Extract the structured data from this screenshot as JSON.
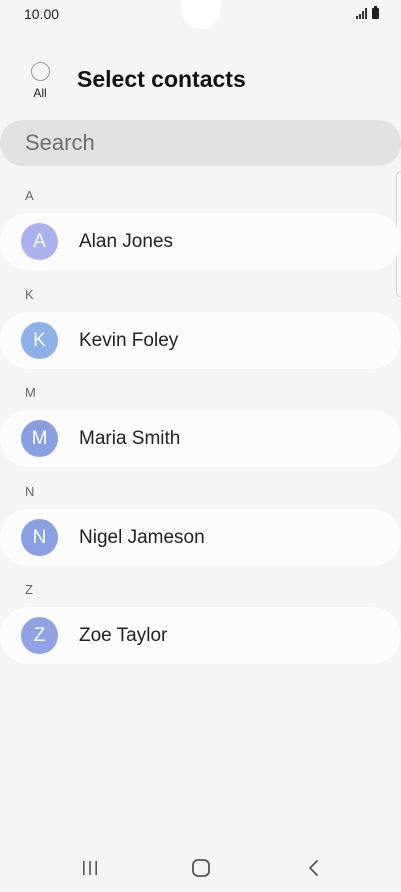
{
  "status_bar": {
    "time": "10.00",
    "icons": [
      "signal-icon",
      "battery-icon"
    ]
  },
  "header": {
    "all_label": "All",
    "title": "Select contacts"
  },
  "search": {
    "placeholder": "Search"
  },
  "sections": [
    {
      "letter": "A",
      "contact": {
        "initial": "A",
        "name": "Alan Jones",
        "avatar_color": "#a9b2ee"
      }
    },
    {
      "letter": "K",
      "contact": {
        "initial": "K",
        "name": "Kevin Foley",
        "avatar_color": "#8eb0e8"
      }
    },
    {
      "letter": "M",
      "contact": {
        "initial": "M",
        "name": "Maria Smith",
        "avatar_color": "#8a9ee2"
      }
    },
    {
      "letter": "N",
      "contact": {
        "initial": "N",
        "name": "Nigel Jameson",
        "avatar_color": "#8aa0e2"
      }
    },
    {
      "letter": "Z",
      "contact": {
        "initial": "Z",
        "name": "Zoe Taylor",
        "avatar_color": "#8fa2e4"
      }
    }
  ],
  "nav_bar": {
    "icons": [
      "recent-apps-icon",
      "home-icon",
      "back-icon"
    ]
  }
}
